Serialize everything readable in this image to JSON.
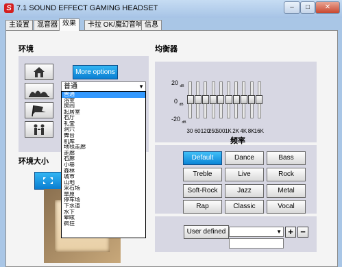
{
  "window": {
    "logo_letter": "S",
    "title": "7.1 SOUND EFFECT GAMING HEADSET",
    "minimize": "–",
    "maximize": "□",
    "close": "✕"
  },
  "tabs": [
    "主设置",
    "混音器",
    "效果",
    "卡拉 OK/魔幻音响",
    "信息"
  ],
  "active_tab": "效果",
  "environment": {
    "heading": "环境",
    "icons": [
      "house-icon",
      "opera-house-icon",
      "flag-icon",
      "people-icon"
    ],
    "more_options_label": "More options",
    "selected_value": "普通",
    "options": [
      "普通",
      "浴室",
      "房间",
      "起居室",
      "石厅",
      "礼堂",
      "洞穴",
      "舞台",
      "机库",
      "地毯走廊",
      "走廊",
      "石廊",
      "小巷",
      "森林",
      "城市",
      "山地",
      "采石场",
      "草原",
      "停车场",
      "下水道",
      "水下",
      "晕眩",
      "疯狂"
    ],
    "highlighted_option": "普通",
    "size_heading": "环境大小"
  },
  "equalizer": {
    "heading": "均衡器",
    "db_labels": [
      {
        "value": "20",
        "unit": "dB"
      },
      {
        "value": "0",
        "unit": "dB"
      },
      {
        "value": "-20",
        "unit": "dB"
      }
    ],
    "bands": [
      {
        "freq": "30",
        "gain": 0
      },
      {
        "freq": "60",
        "gain": 0
      },
      {
        "freq": "120",
        "gain": 0
      },
      {
        "freq": "250",
        "gain": 0
      },
      {
        "freq": "500",
        "gain": 0
      },
      {
        "freq": "1K",
        "gain": 0
      },
      {
        "freq": "2K",
        "gain": 0
      },
      {
        "freq": "4K",
        "gain": 0
      },
      {
        "freq": "8K",
        "gain": 0
      },
      {
        "freq": "16K",
        "gain": 0
      }
    ],
    "gain_range_db": [
      -20,
      20
    ],
    "freq_heading": "频率",
    "presets": [
      "Default",
      "Dance",
      "Bass",
      "Treble",
      "Live",
      "Rock",
      "Soft-Rock",
      "Jazz",
      "Metal",
      "Rap",
      "Classic",
      "Vocal"
    ],
    "active_preset": "Default",
    "user_defined_label": "User defined",
    "user_select_value": "",
    "user_name_value": "",
    "plus_label": "+",
    "minus_label": "−"
  },
  "colors": {
    "accent_blue": "#0a7ed1",
    "selection": "#3399ff",
    "close_red": "#c9472f",
    "panel": "#d7d7e3"
  }
}
